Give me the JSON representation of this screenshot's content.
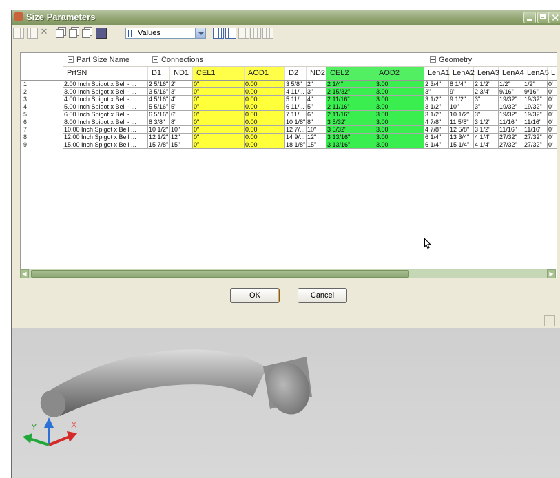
{
  "window": {
    "title": "Size Parameters"
  },
  "toolbar": {
    "view_selected": "Values"
  },
  "grid": {
    "groups": [
      {
        "label": "Part Size Name"
      },
      {
        "label": "Connections"
      },
      {
        "label": "Geometry"
      }
    ],
    "columns": [
      "PrtSN",
      "D1",
      "ND1",
      "CEL1",
      "AOD1",
      "D2",
      "ND2",
      "CEL2",
      "AOD2",
      "LenA1",
      "LenA2",
      "LenA3",
      "LenA4",
      "LenA5",
      "L"
    ],
    "rows": [
      {
        "num": "1",
        "cells": [
          "2.00 Inch Spigot x Bell - ...",
          "2 5/16\"",
          "2\"",
          "0\"",
          "0.00",
          "3 5/8\"",
          "2\"",
          "2 1/4\"",
          "3.00",
          "2 3/4\"",
          "8 1/4\"",
          "2 1/2\"",
          "1/2\"",
          "1/2\"",
          "0'"
        ]
      },
      {
        "num": "2",
        "cells": [
          "3.00 Inch Spigot x Bell - ...",
          "3 5/16\"",
          "3\"",
          "0\"",
          "0.00",
          "4 11/...",
          "3\"",
          "2 15/32\"",
          "3.00",
          "3\"",
          "9\"",
          "2 3/4\"",
          "9/16\"",
          "9/16\"",
          "0'"
        ]
      },
      {
        "num": "3",
        "cells": [
          "4.00 Inch Spigot x Bell - ...",
          "4 5/16\"",
          "4\"",
          "0\"",
          "0.00",
          "5 11/...",
          "4\"",
          "2 11/16\"",
          "3.00",
          "3 1/2\"",
          "9 1/2\"",
          "3\"",
          "19/32\"",
          "19/32\"",
          "0'"
        ]
      },
      {
        "num": "4",
        "cells": [
          "5.00 Inch Spigot x Bell - ...",
          "5 5/16\"",
          "5\"",
          "0\"",
          "0.00",
          "6 11/...",
          "5\"",
          "2 11/16\"",
          "3.00",
          "3 1/2\"",
          "10\"",
          "3\"",
          "19/32\"",
          "19/32\"",
          "0'"
        ]
      },
      {
        "num": "5",
        "cells": [
          "6.00 Inch Spigot x Bell - ...",
          "6 5/16\"",
          "6\"",
          "0\"",
          "0.00",
          "7 11/...",
          "6\"",
          "2 11/16\"",
          "3.00",
          "3 1/2\"",
          "10 1/2\"",
          "3\"",
          "19/32\"",
          "19/32\"",
          "0'"
        ]
      },
      {
        "num": "6",
        "cells": [
          "8.00 Inch Spigot x Bell - ...",
          "8 3/8\"",
          "8\"",
          "0\"",
          "0.00",
          "10 1/8\"",
          "8\"",
          "3 5/32\"",
          "3.00",
          "4 7/8\"",
          "11 5/8\"",
          "3 1/2\"",
          "11/16\"",
          "11/16\"",
          "0'"
        ]
      },
      {
        "num": "7",
        "cells": [
          "10.00 Inch Spigot x Bell ...",
          "10 1/2\"",
          "10\"",
          "0\"",
          "0.00",
          "12 7/...",
          "10\"",
          "3 5/32\"",
          "3.00",
          "4 7/8\"",
          "12 5/8\"",
          "3 1/2\"",
          "11/16\"",
          "11/16\"",
          "0'"
        ]
      },
      {
        "num": "8",
        "cells": [
          "12.00 Inch Spigot x Bell ...",
          "12 1/2\"",
          "12\"",
          "0\"",
          "0.00",
          "14 9/...",
          "12\"",
          "3 13/16\"",
          "3.00",
          "6 1/4\"",
          "13 3/4\"",
          "4 1/4\"",
          "27/32\"",
          "27/32\"",
          "0'"
        ]
      },
      {
        "num": "9",
        "cells": [
          "15.00 Inch Spigot x Bell ...",
          "15 7/8\"",
          "15\"",
          "0\"",
          "0.00",
          "18 1/8\"",
          "15\"",
          "3 13/16\"",
          "3.00",
          "6 1/4\"",
          "15 1/4\"",
          "4 1/4\"",
          "27/32\"",
          "27/32\"",
          "0'"
        ]
      }
    ]
  },
  "buttons": {
    "ok": "OK",
    "cancel": "Cancel"
  },
  "axes": {
    "x": "X",
    "y": "Y"
  },
  "colors": {
    "cel_highlight": "#ffff3a",
    "cel2_highlight": "#3bee4f",
    "title_bar": "#93a673"
  },
  "icons": [
    "app-icon",
    "minimize-icon",
    "maximize-icon",
    "close-icon",
    "add-row-icon",
    "delete-row-icon",
    "delete-icon",
    "copy-icon",
    "paste-icon",
    "paste-special-icon",
    "save-icon",
    "columns-icon",
    "dropdown-arrow-icon",
    "mouse-cursor-icon",
    "ucs-axis-icon"
  ]
}
